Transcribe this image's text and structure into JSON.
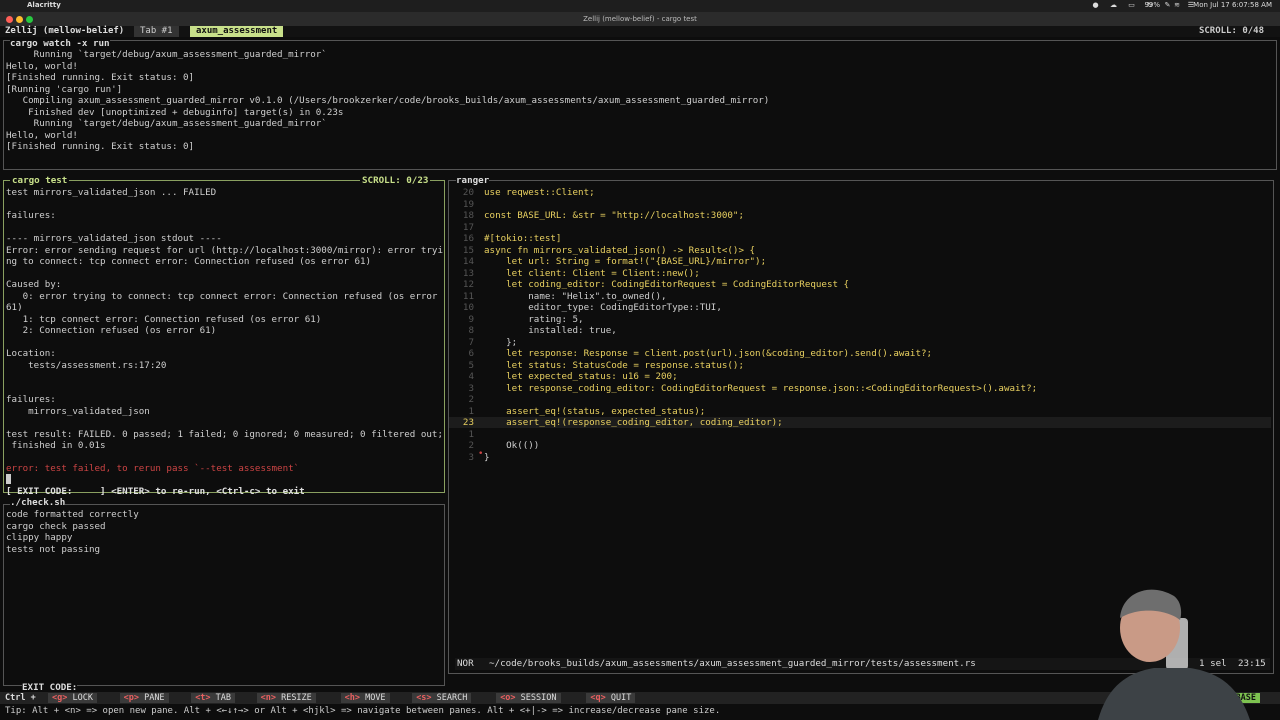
{
  "menubar": {
    "app": "Alacritty",
    "battery": "99%",
    "clock": "Mon Jul 17  6:07:58 AM"
  },
  "window": {
    "title": "Zellij (mellow-belief) - cargo test"
  },
  "tabbar": {
    "session": "Zellij (mellow-belief)",
    "tabs": [
      "Tab #1",
      "axum_assessment"
    ],
    "scroll": "SCROLL:  0/48"
  },
  "top_pane": {
    "title": "cargo watch -x run",
    "lines": [
      "     Running `target/debug/axum_assessment_guarded_mirror`",
      "Hello, world!",
      "[Finished running. Exit status: 0]",
      "[Running 'cargo run']",
      "   Compiling axum_assessment_guarded_mirror v0.1.0 (/Users/brookzerker/code/brooks_builds/axum_assessments/axum_assessment_guarded_mirror)",
      "    Finished dev [unoptimized + debuginfo] target(s) in 0.23s",
      "     Running `target/debug/axum_assessment_guarded_mirror`",
      "Hello, world!",
      "[Finished running. Exit status: 0]"
    ]
  },
  "test_pane": {
    "title": "cargo test",
    "scroll": "SCROLL:  0/23",
    "lines": [
      "test mirrors_validated_json ... FAILED",
      "",
      "failures:",
      "",
      "---- mirrors_validated_json stdout ----",
      "Error: error sending request for url (http://localhost:3000/mirror): error tryi",
      "ng to connect: tcp connect error: Connection refused (os error 61)",
      "",
      "Caused by:",
      "   0: error trying to connect: tcp connect error: Connection refused (os error",
      "61)",
      "   1: tcp connect error: Connection refused (os error 61)",
      "   2: Connection refused (os error 61)",
      "",
      "Location:",
      "    tests/assessment.rs:17:20",
      "",
      "",
      "failures:",
      "    mirrors_validated_json",
      "",
      "test result: FAILED. 0 passed; 1 failed; 0 ignored; 0 measured; 0 filtered out;",
      " finished in 0.01s",
      "",
      "error: test failed, to rerun pass `--test assessment`"
    ],
    "exit_line": "[ EXIT CODE:     ] <ENTER> to re-run, <Ctrl-c> to exit"
  },
  "check_pane": {
    "title": "./check.sh",
    "lines": [
      "code formatted correctly",
      "cargo check passed",
      "clippy happy",
      "tests not passing"
    ],
    "exit_line": "EXIT CODE:"
  },
  "ranger_pane": {
    "title": "ranger",
    "line_numbers": [
      "20",
      "19",
      "18",
      "17",
      "16",
      "15",
      "14",
      "13",
      "12",
      "11",
      "10",
      "9",
      "8",
      "7",
      "6",
      "5",
      "4",
      "3",
      "2",
      "1",
      "23",
      "1",
      "2",
      "3"
    ],
    "lines": [
      "use reqwest::Client;",
      "",
      "const BASE_URL: &str = \"http://localhost:3000\";",
      "",
      "#[tokio::test]",
      "async fn mirrors_validated_json() -> Result<()> {",
      "    let url: String = format!(\"{BASE_URL}/mirror\");",
      "    let client: Client = Client::new();",
      "    let coding_editor: CodingEditorRequest = CodingEditorRequest {",
      "        name: \"Helix\".to_owned(),",
      "        editor_type: CodingEditorType::TUI,",
      "        rating: 5,",
      "        installed: true,",
      "    };",
      "    let response: Response = client.post(url).json(&coding_editor).send().await?;",
      "    let status: StatusCode = response.status();",
      "    let expected_status: u16 = 200;",
      "    let response_coding_editor: CodingEditorRequest = response.json::<CodingEditorRequest>().await?;",
      "",
      "    assert_eq!(status, expected_status);",
      "    assert_eq!(response_coding_editor, coding_editor);",
      "",
      "    Ok(())",
      "}"
    ],
    "status": {
      "mode": "NOR",
      "path": "~/code/brooks_builds/axum_assessments/axum_assessment_guarded_mirror/tests/assessment.rs",
      "sel": "1 sel",
      "pos": "23:15"
    }
  },
  "bottombar": {
    "prefix": "Ctrl +",
    "keys": [
      {
        "k": "<g>",
        "label": "LOCK"
      },
      {
        "k": "<p>",
        "label": "PANE"
      },
      {
        "k": "<t>",
        "label": "TAB"
      },
      {
        "k": "<n>",
        "label": "RESIZE"
      },
      {
        "k": "<h>",
        "label": "MOVE"
      },
      {
        "k": "<s>",
        "label": "SEARCH"
      },
      {
        "k": "<o>",
        "label": "SESSION"
      },
      {
        "k": "<q>",
        "label": "QUIT"
      }
    ],
    "mode": "BASE"
  },
  "tip": "Tip: Alt + <n> => open new pane. Alt + <←↓↑→> or Alt + <hjkl> => navigate between panes. Alt + <+|-> => increase/decrease pane size.",
  "colors": {
    "accent_green": "#8aa060",
    "title_green": "#c8e08a",
    "mode_green": "#7dc250",
    "error_red": "#cc4444",
    "keyword_yellow": "#e8d060"
  }
}
